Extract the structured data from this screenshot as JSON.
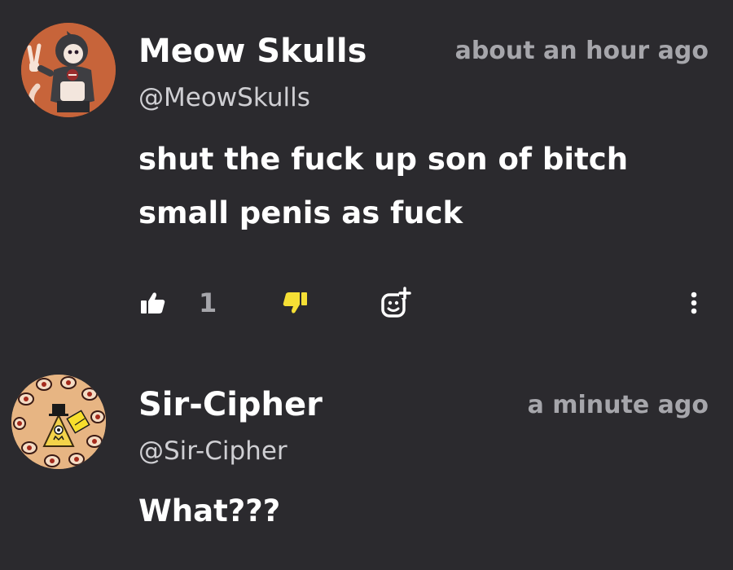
{
  "comments": [
    {
      "author": "Meow Skulls",
      "handle": "@MeowSkulls",
      "time": "about an hour ago",
      "body_lines": [
        "shut the fuck up son of bitch",
        "small penis as fuck"
      ],
      "likes": "1",
      "dislike_active": true,
      "avatar_bg": "#c7643a"
    },
    {
      "author": "Sir-Cipher",
      "handle": "@Sir-Cipher",
      "time": "a minute ago",
      "body_lines": [
        "What???"
      ],
      "avatar_bg": "#e7b583"
    }
  ],
  "colors": {
    "background": "#2b2a2e",
    "text": "#ffffff",
    "muted": "#a6a6ab",
    "dislike_active": "#f5df35"
  },
  "icons": {
    "like": "thumbs-up-icon",
    "dislike": "thumbs-down-icon",
    "react": "add-emoji-icon",
    "more": "more-vertical-icon"
  }
}
